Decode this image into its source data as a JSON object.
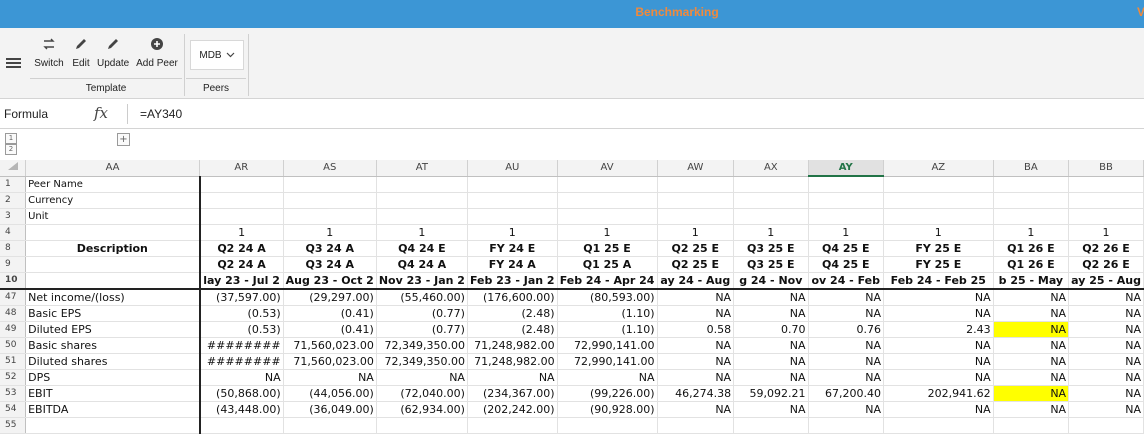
{
  "app": {
    "title": "Benchmarking",
    "title_extra": "V"
  },
  "ribbon": {
    "buttons": [
      {
        "id": "switch",
        "label": "Switch",
        "icon": "switch-arrows-icon"
      },
      {
        "id": "edit",
        "label": "Edit",
        "icon": "pencil-icon"
      },
      {
        "id": "update",
        "label": "Update",
        "icon": "pencil-icon"
      },
      {
        "id": "add_peer",
        "label": "Add Peer",
        "icon": "plus-circle-icon"
      }
    ],
    "template_group_label": "Template",
    "peers_dropdown_value": "MDB",
    "peers_group_label": "Peers"
  },
  "formula_bar": {
    "name_box": "Formula",
    "fx_label": "fx",
    "formula": "=AY340"
  },
  "outline": {
    "levels": [
      "1",
      "2"
    ],
    "expand_symbol": "+"
  },
  "grid": {
    "columns": [
      "AA",
      "AR",
      "AS",
      "AT",
      "AU",
      "AV",
      "AW",
      "AX",
      "AY",
      "AZ",
      "BA",
      "BB"
    ],
    "selected_column": "AY",
    "rows": [
      {
        "n": "1",
        "desc": "Peer Name",
        "cells": [
          "",
          "",
          "",
          "",
          "",
          "",
          "",
          "",
          "",
          "",
          ""
        ]
      },
      {
        "n": "2",
        "desc": "Currency",
        "cells": [
          "",
          "",
          "",
          "",
          "",
          "",
          "",
          "",
          "",
          "",
          ""
        ]
      },
      {
        "n": "3",
        "desc": "Unit",
        "cells": [
          "",
          "",
          "",
          "",
          "",
          "",
          "",
          "",
          "",
          "",
          ""
        ]
      },
      {
        "n": "4",
        "desc": "",
        "cells": [
          "1",
          "1",
          "1",
          "1",
          "1",
          "1",
          "1",
          "1",
          "1",
          "1",
          "1"
        ]
      },
      {
        "n": "8",
        "desc": "Description",
        "cells": [
          "Q2 24 A",
          "Q3 24 A",
          "Q4 24 E",
          "FY 24 E",
          "Q1 25 E",
          "Q2 25 E",
          "Q3 25 E",
          "Q4 25 E",
          "FY 25 E",
          "Q1 26 E",
          "Q2 26 E"
        ]
      },
      {
        "n": "9",
        "desc": "",
        "cells": [
          "Q2 24 A",
          "Q3 24 A",
          "Q4 24 A",
          "FY 24 A",
          "Q1 25 A",
          "Q2 25 E",
          "Q3 25 E",
          "Q4 25 E",
          "FY 25 E",
          "Q1 26 E",
          "Q2 26 E"
        ]
      },
      {
        "n": "10",
        "desc": "",
        "cells": [
          "lay 23 - Jul 2",
          "Aug 23 - Oct 2",
          "Nov 23 - Jan 2",
          "Feb 23 - Jan 2",
          "Feb 24 - Apr 24",
          "ay 24 - Aug",
          "g 24 - Nov",
          "ov 24 - Feb",
          "Feb 24 - Feb 25",
          "b 25 - May",
          "ay 25 - Aug"
        ]
      },
      {
        "n": "47",
        "desc": "Net income/(loss)",
        "cells": [
          "(37,597.00)",
          "(29,297.00)",
          "(55,460.00)",
          "(176,600.00)",
          "(80,593.00)",
          "NA",
          "NA",
          "NA",
          "NA",
          "NA",
          "NA"
        ]
      },
      {
        "n": "48",
        "desc": "Basic EPS",
        "cells": [
          "(0.53)",
          "(0.41)",
          "(0.77)",
          "(2.48)",
          "(1.10)",
          "NA",
          "NA",
          "NA",
          "NA",
          "NA",
          "NA"
        ]
      },
      {
        "n": "49",
        "desc": "Diluted EPS",
        "cells": [
          "(0.53)",
          "(0.41)",
          "(0.77)",
          "(2.48)",
          "(1.10)",
          "0.58",
          "0.70",
          "0.76",
          "2.43",
          "NA",
          "NA"
        ]
      },
      {
        "n": "50",
        "desc": "Basic shares",
        "cells": [
          "########",
          "71,560,023.00",
          "72,349,350.00",
          "71,248,982.00",
          "72,990,141.00",
          "NA",
          "NA",
          "NA",
          "NA",
          "NA",
          "NA"
        ]
      },
      {
        "n": "51",
        "desc": "Diluted shares",
        "cells": [
          "########",
          "71,560,023.00",
          "72,349,350.00",
          "71,248,982.00",
          "72,990,141.00",
          "NA",
          "NA",
          "NA",
          "NA",
          "NA",
          "NA"
        ]
      },
      {
        "n": "52",
        "desc": "DPS",
        "cells": [
          "NA",
          "NA",
          "NA",
          "NA",
          "NA",
          "NA",
          "NA",
          "NA",
          "NA",
          "NA",
          "NA"
        ]
      },
      {
        "n": "53",
        "desc": "EBIT",
        "cells": [
          "(50,868.00)",
          "(44,056.00)",
          "(72,040.00)",
          "(234,367.00)",
          "(99,226.00)",
          "46,274.38",
          "59,092.21",
          "67,200.40",
          "202,941.62",
          "NA",
          "NA"
        ]
      },
      {
        "n": "54",
        "desc": "EBITDA",
        "cells": [
          "(43,448.00)",
          "(36,049.00)",
          "(62,934.00)",
          "(202,242.00)",
          "(90,928.00)",
          "NA",
          "NA",
          "NA",
          "NA",
          "NA",
          "NA"
        ]
      },
      {
        "n": "55",
        "desc": "",
        "cells": [
          "",
          "",
          "",
          "",
          "",
          "",
          "",
          "",
          "",
          "",
          ""
        ]
      }
    ],
    "highlight_color": "#ffff00",
    "accent_color": "#217346"
  }
}
